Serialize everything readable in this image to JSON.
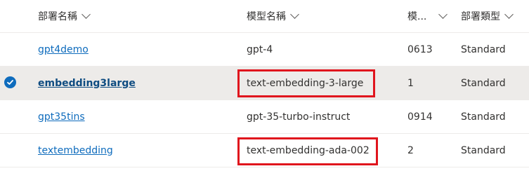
{
  "columns": [
    {
      "label": "部署名稱"
    },
    {
      "label": "模型名稱"
    },
    {
      "label": "模..."
    },
    {
      "label": "部署類型"
    }
  ],
  "rows": [
    {
      "deployment": "gpt4demo",
      "model": "gpt-4",
      "version": "0613",
      "type": "Standard",
      "selected": false,
      "highlighted": false
    },
    {
      "deployment": "embedding3large",
      "model": "text-embedding-3-large",
      "version": "1",
      "type": "Standard",
      "selected": true,
      "highlighted": true
    },
    {
      "deployment": "gpt35tins",
      "model": "gpt-35-turbo-instruct",
      "version": "0914",
      "type": "Standard",
      "selected": false,
      "highlighted": false
    },
    {
      "deployment": "textembedding",
      "model": "text-embedding-ada-002",
      "version": "2",
      "type": "Standard",
      "selected": false,
      "highlighted": true
    }
  ],
  "colors": {
    "accent": "#0f6cbd",
    "highlight": "#e0151d",
    "selected_bg": "#edebe9"
  },
  "icons": {
    "sort": "chevron-down-icon",
    "selected": "checkmark-circle-icon"
  }
}
